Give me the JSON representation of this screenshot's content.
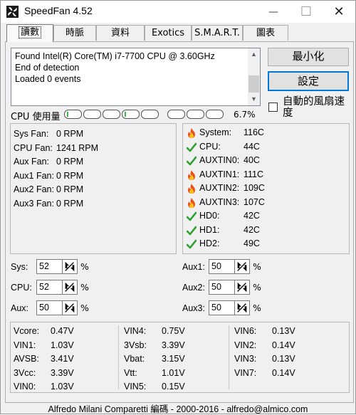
{
  "window": {
    "title": "SpeedFan 4.52",
    "minimize_glyph": "—",
    "maximize_glyph": "☐",
    "close_glyph": "✕"
  },
  "tabs": [
    {
      "label": "讀數",
      "active": true
    },
    {
      "label": "時脈"
    },
    {
      "label": "資料"
    },
    {
      "label": "Exotics"
    },
    {
      "label": "S.M.A.R.T."
    },
    {
      "label": "圖表"
    }
  ],
  "log": {
    "lines": [
      "Found Intel(R) Core(TM) i7-7700 CPU @ 3.60GHz",
      "End of detection",
      "Loaded 0 events"
    ]
  },
  "buttons": {
    "minimize": "最小化",
    "settings": "設定"
  },
  "auto_fan": {
    "label": "自動的風扇速度",
    "checked": false
  },
  "cpu_usage": {
    "label": "CPU 使用量",
    "percent": "6.7%",
    "meters": [
      0.08,
      0.0,
      0.0,
      0.08,
      0.0,
      0.0,
      0.0,
      0.0
    ]
  },
  "fans": [
    {
      "name": "Sys Fan:",
      "value": "0 RPM"
    },
    {
      "name": "CPU Fan:",
      "value": "1241 RPM"
    },
    {
      "name": "Aux Fan:",
      "value": "0 RPM"
    },
    {
      "name": "Aux1 Fan:",
      "value": "0 RPM"
    },
    {
      "name": "Aux2 Fan:",
      "value": "0 RPM"
    },
    {
      "name": "Aux3 Fan:",
      "value": "0 RPM"
    }
  ],
  "temps": [
    {
      "name": "System:",
      "value": "116C",
      "status": "fire-icon"
    },
    {
      "name": "CPU:",
      "value": "44C",
      "status": "check-icon"
    },
    {
      "name": "AUXTIN0:",
      "value": "40C",
      "status": "check-icon"
    },
    {
      "name": "AUXTIN1:",
      "value": "111C",
      "status": "fire-icon"
    },
    {
      "name": "AUXTIN2:",
      "value": "109C",
      "status": "fire-icon"
    },
    {
      "name": "AUXTIN3:",
      "value": "107C",
      "status": "fire-icon"
    },
    {
      "name": "HD0:",
      "value": "42C",
      "status": "check-icon"
    },
    {
      "name": "HD1:",
      "value": "42C",
      "status": "check-icon"
    },
    {
      "name": "HD2:",
      "value": "49C",
      "status": "check-icon"
    }
  ],
  "speeds_left": [
    {
      "label": "Sys:",
      "value": "52",
      "unit": "%"
    },
    {
      "label": "CPU:",
      "value": "52",
      "unit": "%"
    },
    {
      "label": "Aux:",
      "value": "50",
      "unit": "%"
    }
  ],
  "speeds_right": [
    {
      "label": "Aux1:",
      "value": "50",
      "unit": "%"
    },
    {
      "label": "Aux2:",
      "value": "50",
      "unit": "%"
    },
    {
      "label": "Aux3:",
      "value": "50",
      "unit": "%"
    }
  ],
  "voltages": [
    [
      {
        "name": "Vcore:",
        "value": "0.47V"
      },
      {
        "name": "VIN1:",
        "value": "1.03V"
      },
      {
        "name": "AVSB:",
        "value": "3.41V"
      },
      {
        "name": "3Vcc:",
        "value": "3.39V"
      },
      {
        "name": "VIN0:",
        "value": "1.03V"
      }
    ],
    [
      {
        "name": "VIN4:",
        "value": "0.75V"
      },
      {
        "name": "3Vsb:",
        "value": "3.39V"
      },
      {
        "name": "Vbat:",
        "value": "3.15V"
      },
      {
        "name": "Vtt:",
        "value": "1.01V"
      },
      {
        "name": "VIN5:",
        "value": "0.15V"
      }
    ],
    [
      {
        "name": "VIN6:",
        "value": "0.13V"
      },
      {
        "name": "VIN2:",
        "value": "0.14V"
      },
      {
        "name": "VIN3:",
        "value": "0.13V"
      },
      {
        "name": "VIN7:",
        "value": "0.14V"
      }
    ]
  ],
  "footer": "Alfredo Milani Comparetti 編碼 - 2000-2016 - alfredo@almico.com",
  "colors": {
    "hot": "#e8501a",
    "ok": "#2ea02e",
    "accent": "#0078d7"
  }
}
